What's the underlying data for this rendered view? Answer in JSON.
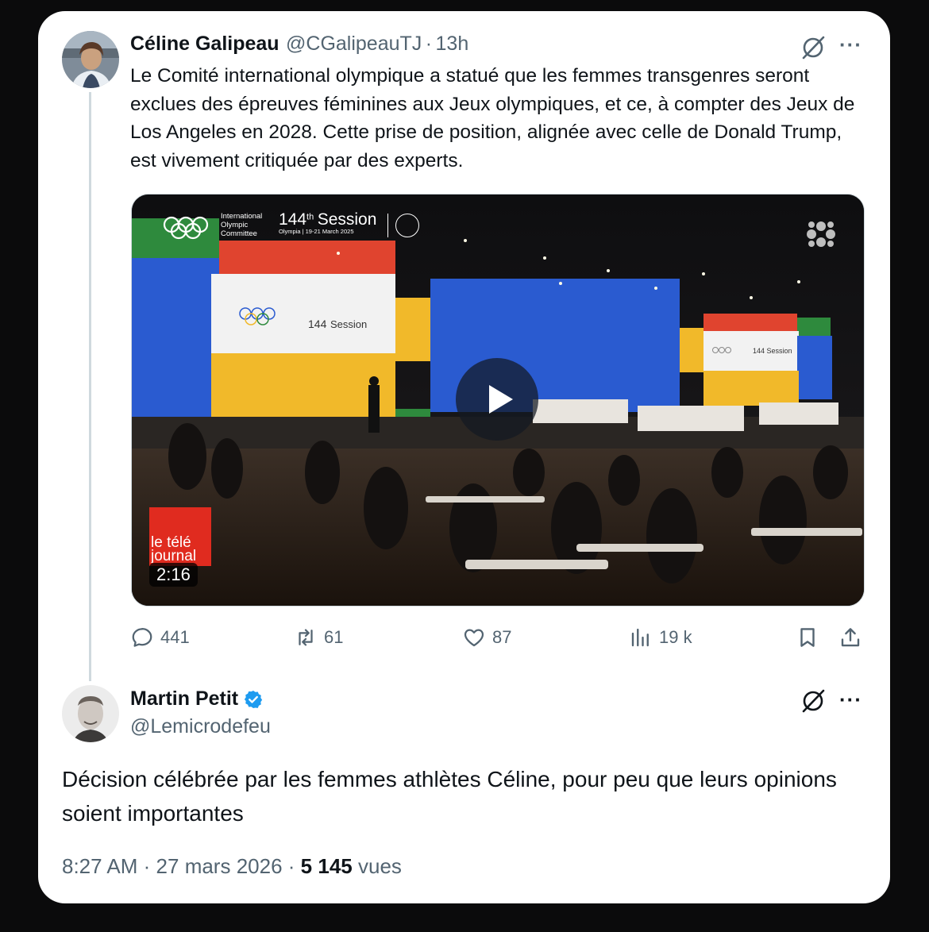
{
  "tweet": {
    "display_name": "Céline Galipeau",
    "handle": "@CGalipeauTJ",
    "separator": "·",
    "time": "13h",
    "text": "Le Comité international olympique a statué que les femmes transgenres seront exclues des épreuves féminines aux Jeux olympiques, et ce, à compter des Jeux de Los Angeles en 2028. Cette prise de position, alignée avec celle de Donald Trump, est vivement critiquée par des experts.",
    "more_label": "···",
    "video": {
      "duration": "2:16",
      "org_name_lines": [
        "International",
        "Olympic",
        "Committee"
      ],
      "session_title": "144",
      "session_sup": "th",
      "session_word": "Session",
      "session_sub": "Olympia | 19-21 March 2025",
      "broadcaster_lines": [
        "le télé",
        "journal"
      ]
    },
    "actions": {
      "replies": "441",
      "reposts": "61",
      "likes": "87",
      "views": "19 k"
    }
  },
  "reply": {
    "display_name": "Martin Petit",
    "handle": "@Lemicrodefeu",
    "more_label": "···",
    "text": "Décision célébrée par les femmes athlètes Céline, pour peu que leurs opinions soient importantes",
    "footer": {
      "time": "8:27 AM",
      "sep1": "·",
      "date": "27 mars 2026",
      "sep2": "·",
      "views_count": "5 145",
      "views_label": "vues"
    }
  },
  "colors": {
    "verified": "#1d9bf0",
    "muted": "#536471",
    "text": "#0f1419",
    "thread_line": "#cfd9de"
  },
  "icons": [
    "grok-icon",
    "more-icon",
    "reply-icon",
    "repost-icon",
    "like-icon",
    "views-icon",
    "bookmark-icon",
    "share-icon",
    "play-icon",
    "verified-badge-icon"
  ]
}
